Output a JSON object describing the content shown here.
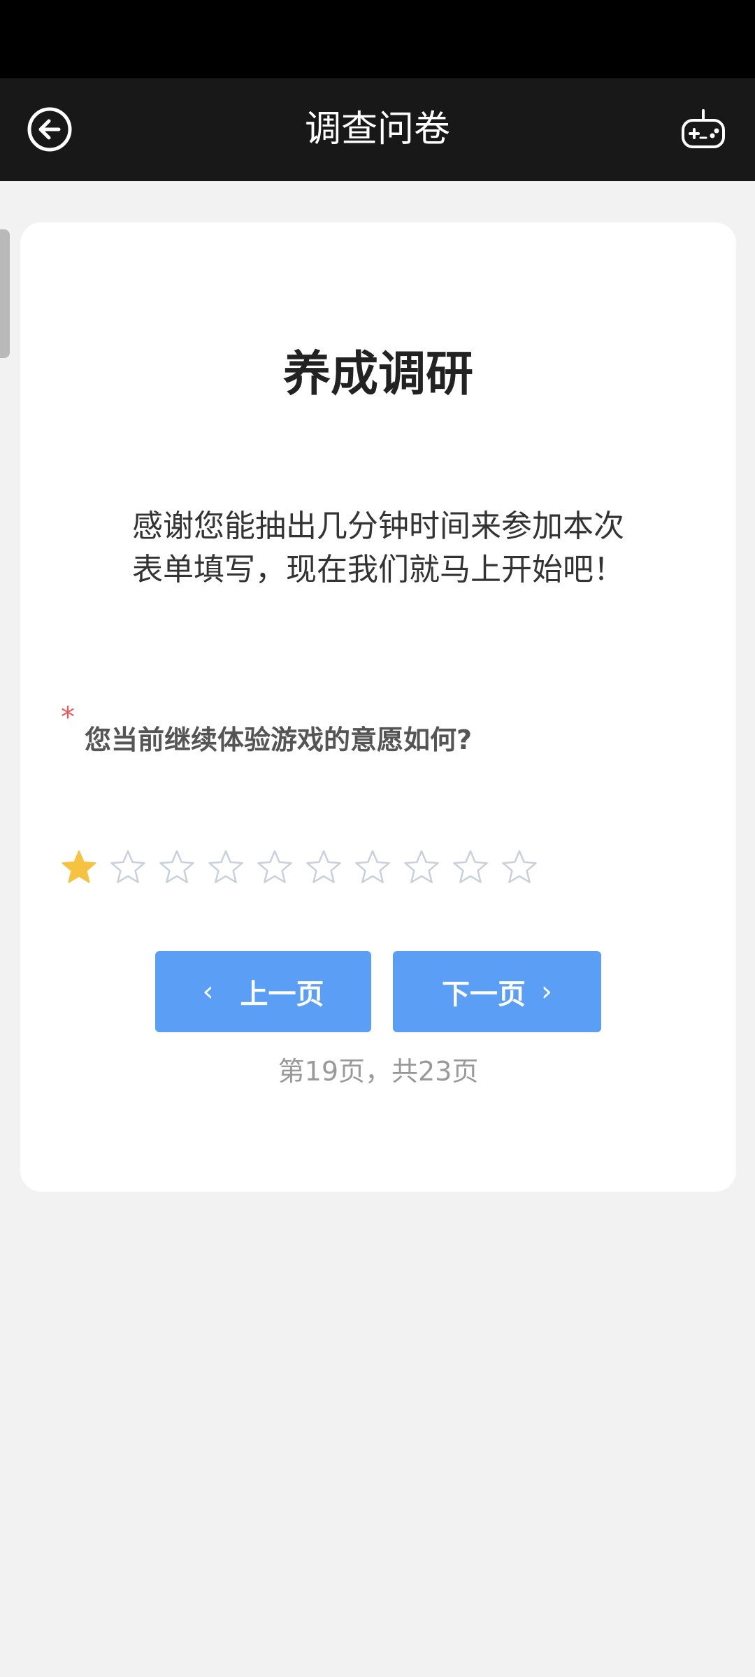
{
  "header": {
    "title": "调查问卷",
    "back_icon": "back-arrow-circle-icon",
    "game_icon": "gamepad-icon"
  },
  "survey": {
    "title": "养成调研",
    "intro": "感谢您能抽出几分钟时间来参加本次表单填写，现在我们就马上开始吧！",
    "question": {
      "required_mark": "*",
      "text": "您当前继续体验游戏的意愿如何?",
      "rating": {
        "value": 1,
        "max": 10
      },
      "filled_color": "#f5c242",
      "empty_color": "#c9cfdb"
    }
  },
  "nav": {
    "prev_label": "上一页",
    "next_label": "下一页",
    "page_indicator": "第19页，共23页",
    "button_color": "#5b9ef5"
  }
}
